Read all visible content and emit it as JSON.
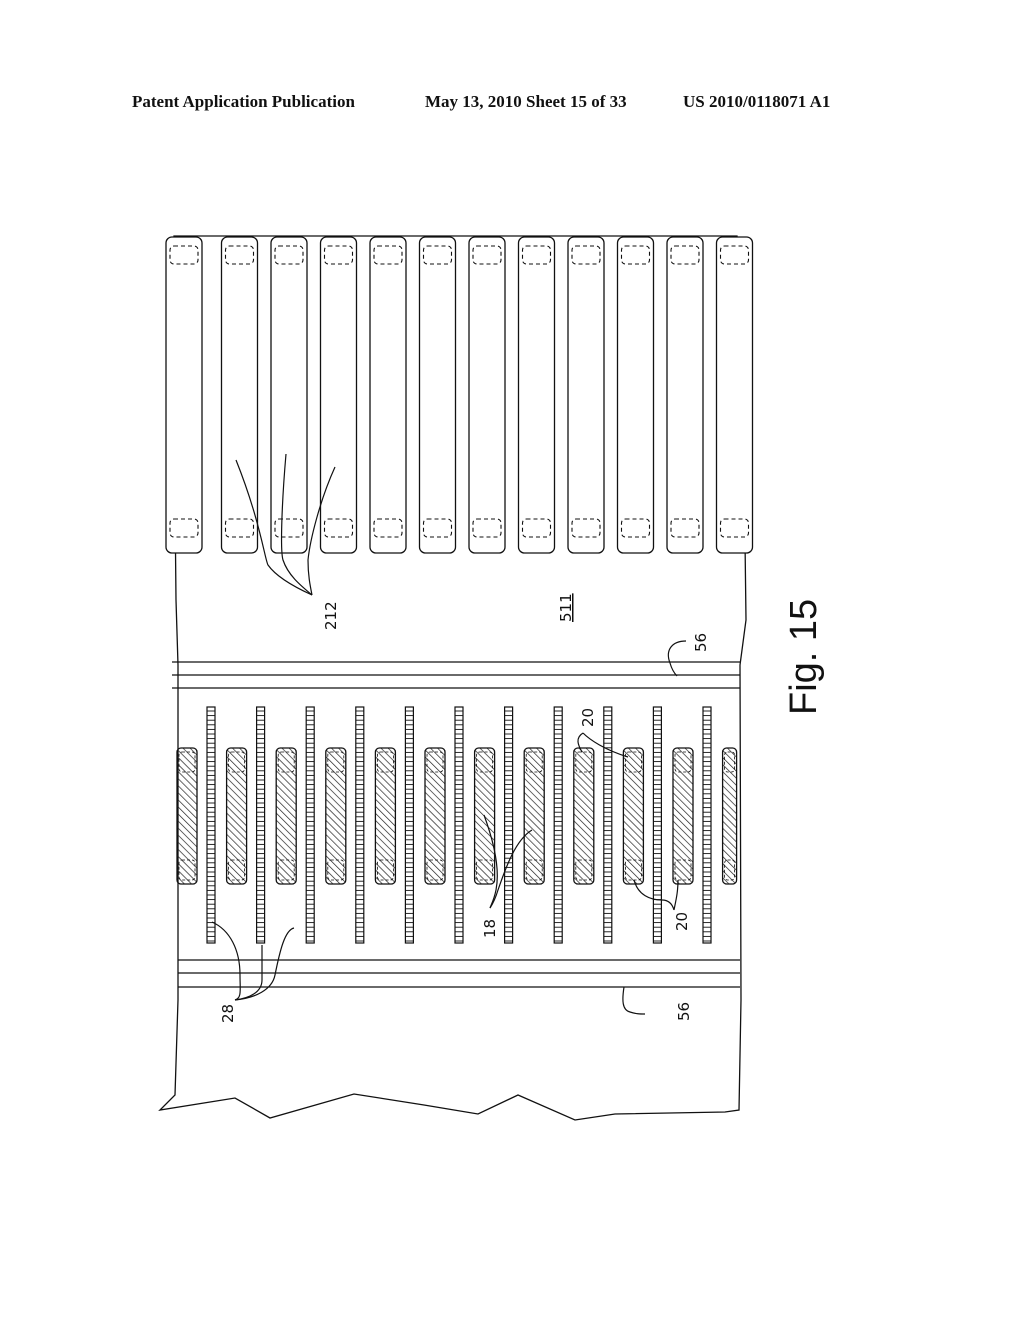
{
  "header": {
    "publication_type": "Patent Application Publication",
    "date_sheet": "May 13, 2010   Sheet 15 of 33",
    "publication_number": "US 2010/0118071 A1"
  },
  "figure": {
    "label": "Fig. 15",
    "reference_labels": {
      "upper_slots": "212",
      "region": "511",
      "separator_upper": "56",
      "separator_lower": "56",
      "hatched_pads_top": "20",
      "hatched_pads_bottom": "20",
      "pad_pair": "18",
      "ladder_strips": "28"
    },
    "counts": {
      "upper_slots": 12,
      "hatched_pads": 12,
      "ladder_strips": 11
    }
  }
}
